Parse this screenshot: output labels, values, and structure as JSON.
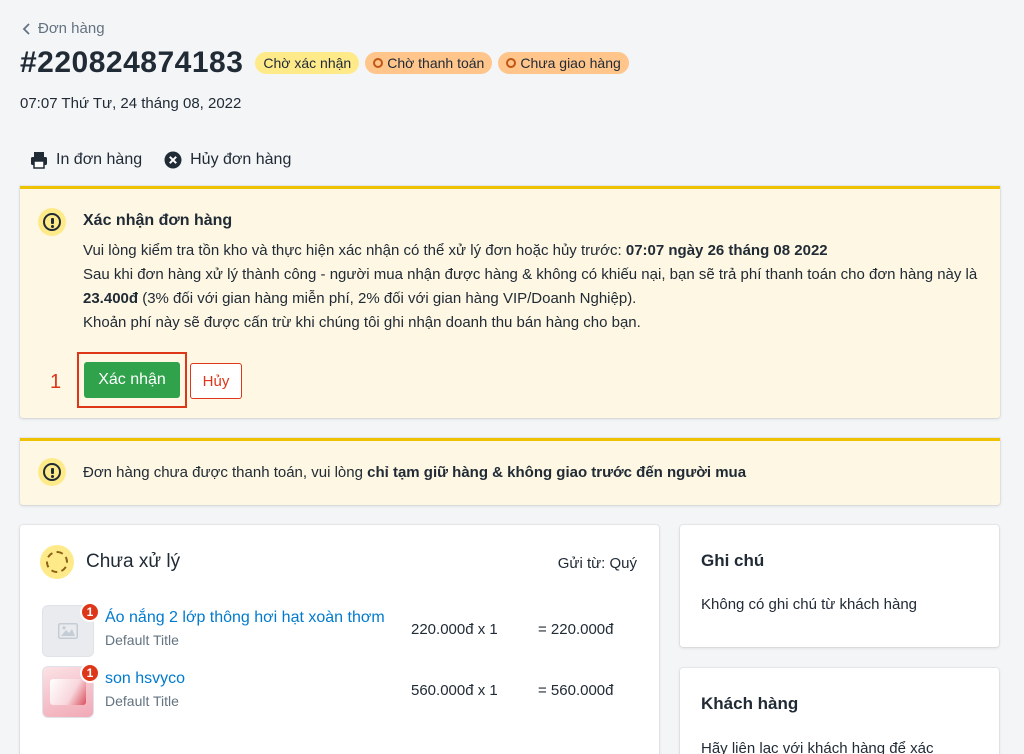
{
  "nav": {
    "back_label": "Đơn hàng"
  },
  "order": {
    "number": "#220824874183",
    "badges": [
      {
        "label": "Chờ xác nhận",
        "color": "#ffea8a"
      },
      {
        "label": "Chờ thanh toán",
        "color": "#ffc58b"
      },
      {
        "label": "Chưa giao hàng",
        "color": "#ffc58b"
      }
    ],
    "date": "07:07 Thứ Tư, 24 tháng 08, 2022"
  },
  "actions": {
    "print": {
      "label": "In đơn hàng",
      "icon": "printer-icon"
    },
    "cancel": {
      "label": "Hủy đơn hàng",
      "icon": "close-circle-icon"
    }
  },
  "confirm_box": {
    "title": "Xác nhận đơn hàng",
    "line1_prefix": "Vui lòng kiểm tra tồn kho và thực hiện xác nhận có thể xử lý đơn hoặc hủy trước: ",
    "line1_deadline": "07:07 ngày 26 tháng 08 2022",
    "line2_prefix": "Sau khi đơn hàng xử lý thành công - người mua nhận được hàng & không có khiếu nại, bạn sẽ trả phí thanh toán cho đơn hàng này là ",
    "line2_fee": "23.400đ",
    "line2_suffix": " (3% đối với gian hàng miễn phí, 2% đối với gian hàng VIP/Doanh Nghiệp).",
    "line3": "Khoản phí này sẽ được cấn trừ khi chúng tôi ghi nhận doanh thu bán hàng cho bạn.",
    "step_number": "1",
    "confirm_label": "Xác nhận",
    "cancel_label": "Hủy",
    "accent_color": "#eec200"
  },
  "payment_box": {
    "text_prefix": "Đơn hàng chưa được thanh toán, vui lòng ",
    "text_bold": "chỉ tạm giữ hàng & không giao trước đến người mua"
  },
  "fulfillment": {
    "heading": "Chưa xử lý",
    "ship_from": "Gửi từ: Quý",
    "items": [
      {
        "qty_badge": "1",
        "name": "Áo nắng 2 lớp thông hơi hạt xoàn thơm",
        "variant": "Default Title",
        "price": "220.000đ x 1",
        "total": "=  220.000đ"
      },
      {
        "qty_badge": "1",
        "name": "son hsvyco",
        "variant": "Default Title",
        "price": "560.000đ x 1",
        "total": "=  560.000đ"
      }
    ]
  },
  "note": {
    "heading": "Ghi chú",
    "text": "Không có ghi chú từ khách hàng"
  },
  "customer": {
    "heading": "Khách hàng",
    "text": "Hãy liên lạc với khách hàng để xác"
  },
  "colors": {
    "primary_green": "#31a24c",
    "danger_red": "#de3618",
    "link_blue": "#007ace"
  }
}
